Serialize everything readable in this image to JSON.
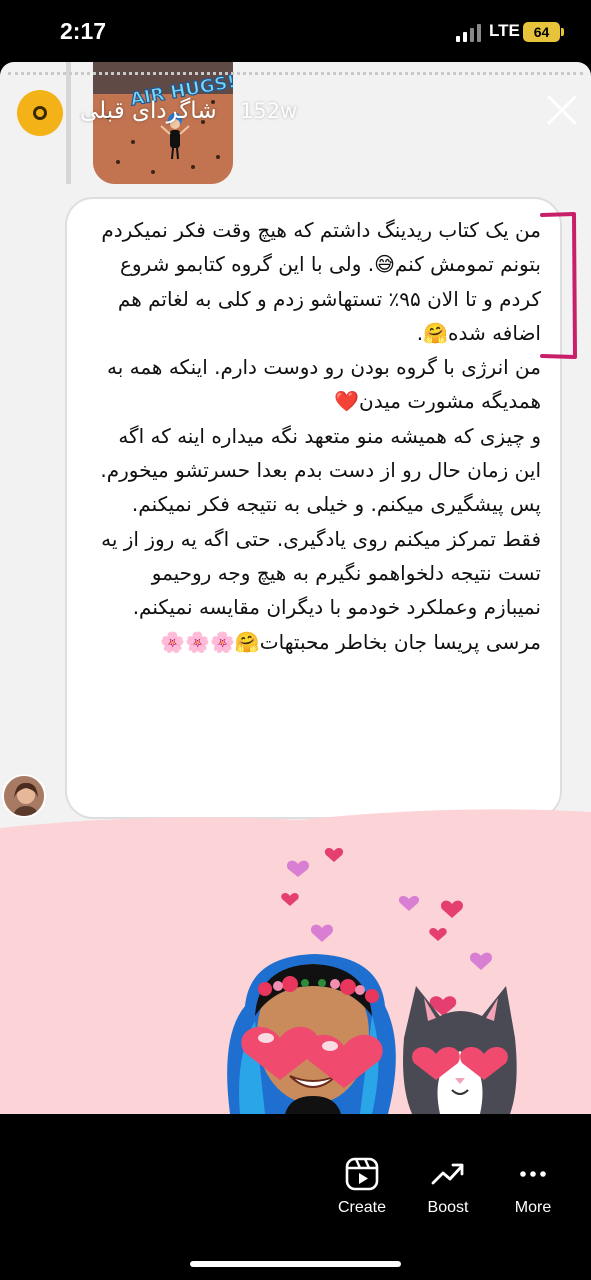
{
  "status_bar": {
    "time": "2:17",
    "network": "LTE",
    "battery": "64"
  },
  "story": {
    "author_name": "شاگردای قبلی",
    "age": "152w",
    "attached_image_caption": "AIR HUGS!"
  },
  "message": {
    "text": "من یک کتاب ریدینگ داشتم که هیچ وقت فکر نمیکردم بتونم تمومش کنم😅. ولی با این گروه کتابمو شروع کردم و تا الان ۹۵٪ تستهاشو زدم و کلی به لغاتم هم اضافه شده🤗.\nمن انرژی با گروه بودن رو دوست دارم. اینکه همه به همدیگه مشورت میدن❤️\nو چیزی که همیشه منو متعهد نگه میداره اینه که اگه این زمان حال رو از دست بدم بعدا حسرتشو میخورم. پس پیشگیری میکنم. و خیلی به نتیجه فکر نمیکنم. فقط تمرکز میکنم روی یادگیری. حتی اگه یه روز از یه تست نتیجه دلخواهمو نگیرم به هیچ وجه روحیمو نمیبازم وعملکرد خودمو با دیگران مقایسه نمیکنم.\nمرسی پریسا جان بخاطر محبتهات🤗🌸🌸🌸"
  },
  "bottom_bar": {
    "actions": [
      {
        "label": "Create",
        "icon": "reels-create-icon"
      },
      {
        "label": "Boost",
        "icon": "trending-up-icon"
      },
      {
        "label": "More",
        "icon": "more-dots-icon"
      }
    ]
  },
  "colors": {
    "story_avatar": "#f3b318",
    "highlight_bracket": "#c81f6a",
    "sticker_background": "#fcd3d6",
    "battery": "#e7c33b"
  }
}
